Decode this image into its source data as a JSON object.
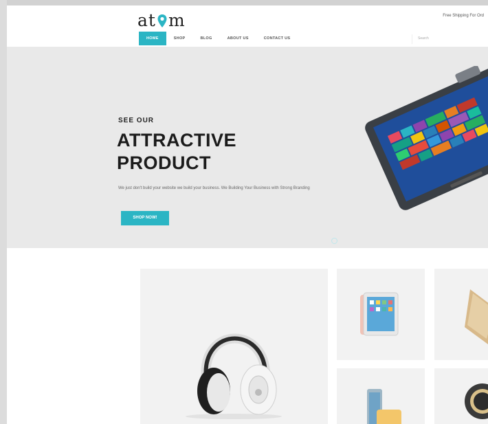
{
  "brand": {
    "logo_left": "at",
    "logo_right": "m",
    "accent": "#2bb5c4"
  },
  "header": {
    "shipping_text": "Free Shipping For Ord"
  },
  "nav": {
    "items": [
      "HOME",
      "SHOP",
      "BLOG",
      "ABOUT US",
      "CONTACT US"
    ],
    "active_index": 0
  },
  "search": {
    "placeholder": "Search"
  },
  "hero": {
    "kicker": "SEE OUR",
    "headline_line1": "ATTRACTIVE",
    "headline_line2": "PRODUCT",
    "blurb": "We just don't build your website we build your business. We Building Your Business with Strong Branding",
    "cta": "SHOP NOW!"
  },
  "products": {
    "featured_icon": "headphones-image",
    "items": [
      "tablet-image",
      "laptop-image",
      "phone-image",
      "watch-image"
    ]
  }
}
